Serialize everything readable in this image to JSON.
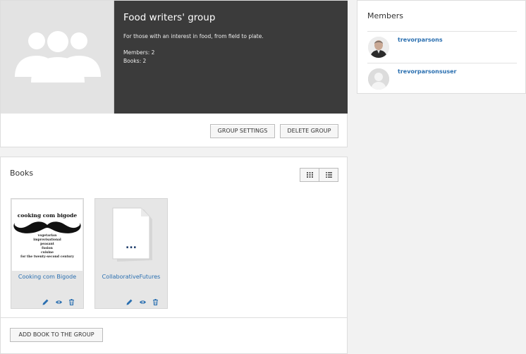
{
  "group": {
    "title": "Food writers' group",
    "description": "For those with an interest in food, from field to plate.",
    "members_count": "Members: 2",
    "books_count": "Books: 2",
    "settings_label": "GROUP SETTINGS",
    "delete_label": "DELETE GROUP"
  },
  "books": {
    "heading": "Books",
    "view_modes": [
      "grid-icon",
      "list-icon"
    ],
    "items": [
      {
        "title": "Cooking com Bigode",
        "cover_title": "cooking com bigode",
        "cover_lines": [
          "vegetarian",
          "improvisational",
          "peasant",
          "fusion",
          "cuisine",
          "for the twenty-second century"
        ]
      },
      {
        "title": "CollaborativeFutures",
        "cover_placeholder": "..."
      }
    ],
    "actions": [
      "pencil-icon",
      "eye-icon",
      "trash-icon"
    ],
    "add_label": "ADD BOOK TO THE GROUP"
  },
  "members": {
    "heading": "Members",
    "list": [
      {
        "name": "trevorparsons"
      },
      {
        "name": "trevorparsonsuser"
      }
    ]
  },
  "colors": {
    "link": "#2a6fb0",
    "header_dark": "#3b3b3b",
    "panel_bg": "#ffffff",
    "page_bg": "#f2f2f2"
  }
}
